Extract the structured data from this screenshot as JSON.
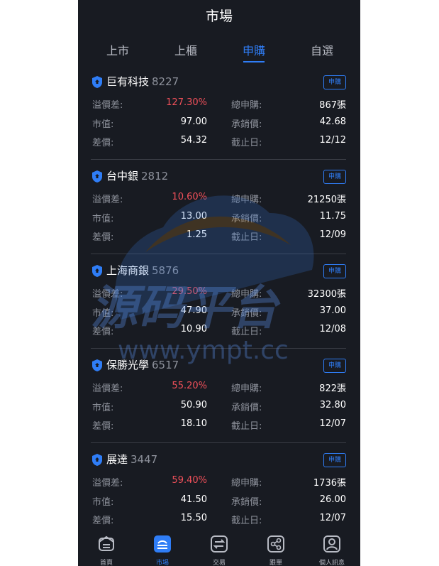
{
  "header": {
    "title": "市場"
  },
  "tabs": [
    {
      "label": "上市"
    },
    {
      "label": "上櫃"
    },
    {
      "label": "申購"
    },
    {
      "label": "自選"
    }
  ],
  "active_tab": "申購",
  "labels": {
    "premium": "溢價差:",
    "market_value": "市值:",
    "spread": "差價:",
    "total_subscription": "總申購:",
    "underwriting_price": "承銷價:",
    "deadline": "截止日:"
  },
  "stocks": [
    {
      "name": "巨有科技",
      "code": "8227",
      "badge": "申購",
      "premium": "127.30%",
      "market_value": "97.00",
      "spread": "54.32",
      "total_subscription": "867張",
      "underwriting_price": "42.68",
      "deadline": "12/12"
    },
    {
      "name": "台中銀",
      "code": "2812",
      "badge": "申購",
      "premium": "10.60%",
      "market_value": "13.00",
      "spread": "1.25",
      "total_subscription": "21250張",
      "underwriting_price": "11.75",
      "deadline": "12/09"
    },
    {
      "name": "上海商銀",
      "code": "5876",
      "badge": "申購",
      "premium": "29.50%",
      "market_value": "47.90",
      "spread": "10.90",
      "total_subscription": "32300張",
      "underwriting_price": "37.00",
      "deadline": "12/08"
    },
    {
      "name": "保勝光學",
      "code": "6517",
      "badge": "申購",
      "premium": "55.20%",
      "market_value": "50.90",
      "spread": "18.10",
      "total_subscription": "822張",
      "underwriting_price": "32.80",
      "deadline": "12/07"
    },
    {
      "name": "展達",
      "code": "3447",
      "badge": "申購",
      "premium": "59.40%",
      "market_value": "41.50",
      "spread": "15.50",
      "total_subscription": "1736張",
      "underwriting_price": "26.00",
      "deadline": "12/07"
    }
  ],
  "watermark": {
    "brand": "源码平台",
    "url": "www.ympt.cc"
  },
  "bottom_nav": [
    {
      "label": "首頁",
      "icon": "home-icon"
    },
    {
      "label": "市場",
      "icon": "market-icon"
    },
    {
      "label": "交易",
      "icon": "exchange-icon"
    },
    {
      "label": "跟單",
      "icon": "share-icon"
    },
    {
      "label": "個人訊息",
      "icon": "user-icon"
    }
  ],
  "active_nav": "市場",
  "colors": {
    "background": "#181b22",
    "accent": "#2f7df6",
    "premium_red": "#f0505a",
    "text_primary": "#ffffff",
    "text_muted": "#8d919b"
  }
}
